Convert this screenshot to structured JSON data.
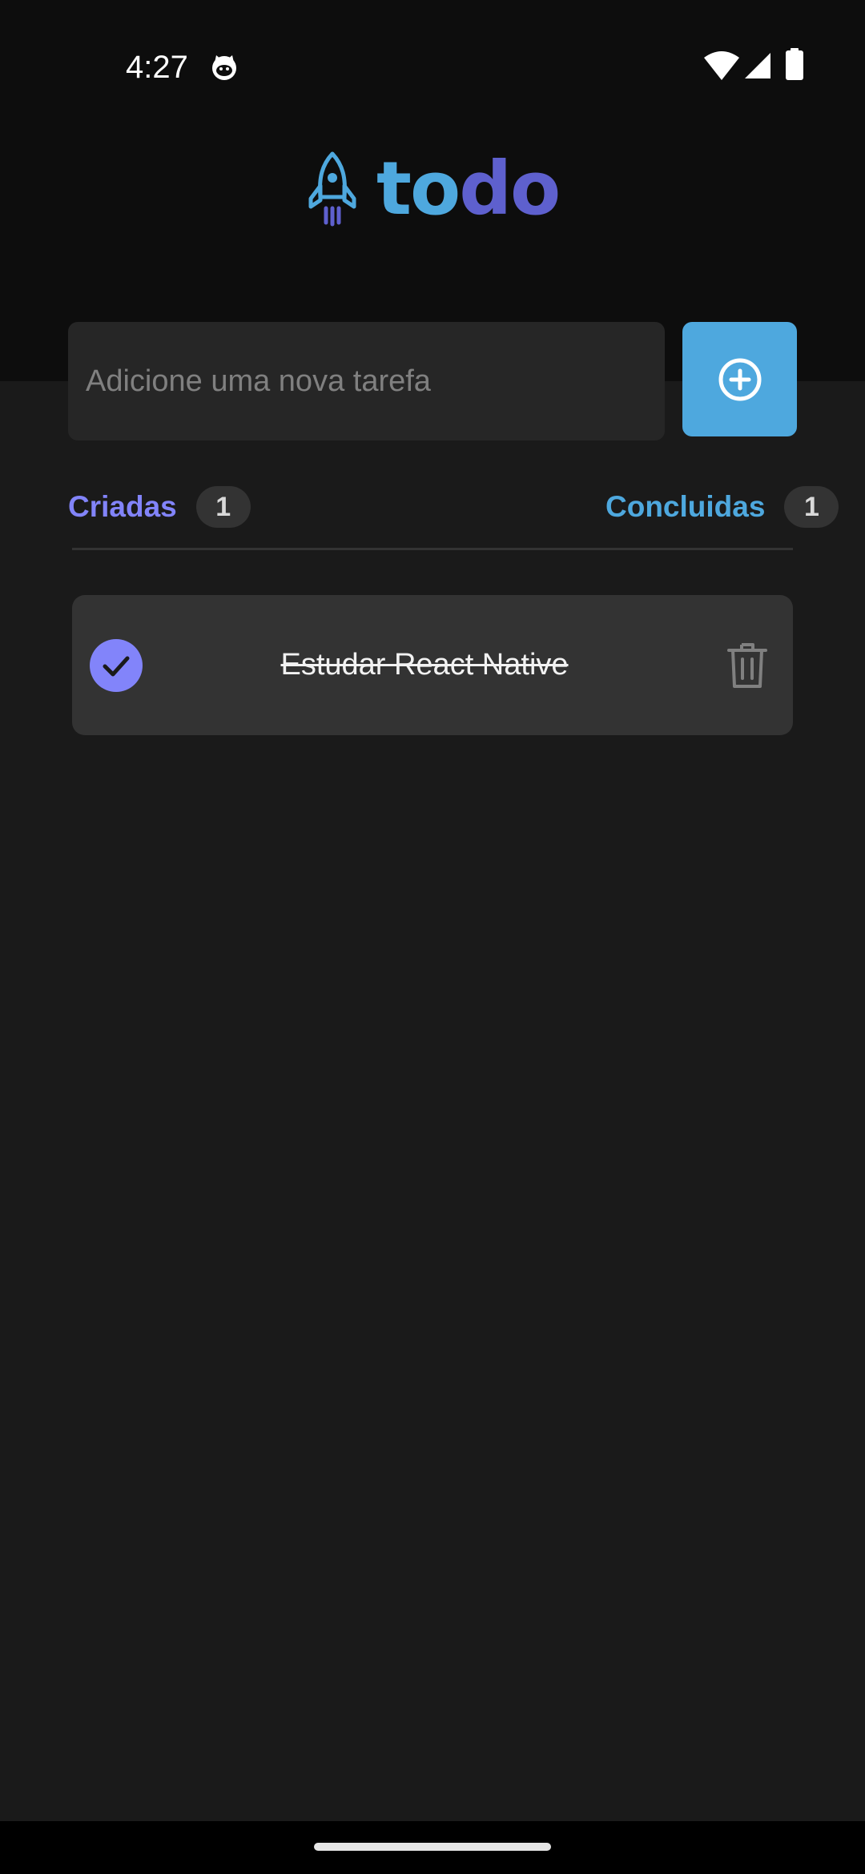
{
  "status_bar": {
    "time": "4:27",
    "notification_icon": "cat-face-icon",
    "wifi_icon": "wifi-icon",
    "signal_icon": "cellular-signal-icon",
    "battery_icon": "battery-icon"
  },
  "header": {
    "logo_icon": "rocket-icon",
    "logo_text_part1": "to",
    "logo_text_part2": "do"
  },
  "new_task": {
    "value": "",
    "placeholder": "Adicione uma nova tarefa",
    "add_icon": "plus-circle-icon"
  },
  "counters": {
    "created_label": "Criadas",
    "created_count": "1",
    "done_label": "Concluidas",
    "done_count": "1"
  },
  "tasks": [
    {
      "text": "Estudar React Native",
      "done": true,
      "check_icon": "checkmark-icon",
      "delete_icon": "trash-icon"
    }
  ],
  "colors": {
    "header_background": "#0d0d0d",
    "background": "#1a1a1a",
    "input_background": "#262626",
    "card_background": "#333333",
    "blue": "#4ea8de",
    "purple": "#5e60ce",
    "purple_light": "#8284fa"
  }
}
